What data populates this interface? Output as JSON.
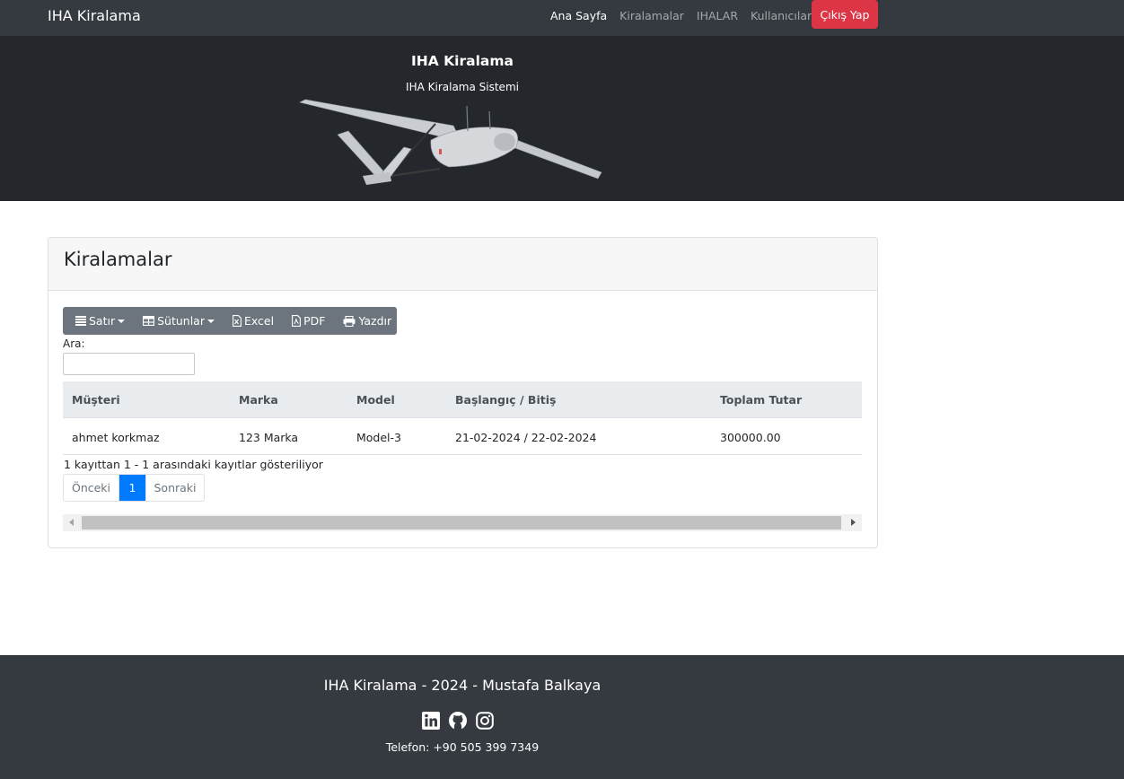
{
  "navbar": {
    "brand": "IHA Kiralama",
    "links": [
      "Ana Sayfa",
      "Kiralamalar",
      "IHALAR",
      "Kullanıcılar"
    ],
    "logout_label": "Çıkış Yap"
  },
  "hero": {
    "title": "IHA Kiralama",
    "subtitle": "IHA Kiralama Sistemi"
  },
  "card": {
    "title": "Kiralamalar",
    "toolbar": {
      "rows_label": "Satır",
      "columns_label": "Sütunlar",
      "excel_label": "Excel",
      "pdf_label": "PDF",
      "print_label": "Yazdır"
    },
    "search": {
      "label": "Ara:",
      "value": ""
    },
    "table": {
      "headers": [
        "Müşteri",
        "Marka",
        "Model",
        "Başlangıç / Bitiş",
        "Toplam Tutar"
      ],
      "rows": [
        [
          "ahmet korkmaz",
          "123 Marka",
          "Model-3",
          "21-02-2024 / 22-02-2024",
          "300000.00"
        ]
      ]
    },
    "info": "1 kayıttan 1 - 1 arasındaki kayıtlar gösteriliyor",
    "pagination": {
      "prev": "Önceki",
      "current": "1",
      "next": "Sonraki"
    }
  },
  "footer": {
    "title": "IHA Kiralama - 2024 - Mustafa Balkaya",
    "icons": [
      "linkedin-icon",
      "github-icon",
      "instagram-icon"
    ],
    "phone": "Telefon: +90 505 399 7349"
  },
  "colors": {
    "navbar_bg": "#343a40",
    "hero_bg": "#24272b",
    "danger": "#dc3545",
    "primary": "#007bff",
    "toolbar_bg": "#6c757d"
  }
}
